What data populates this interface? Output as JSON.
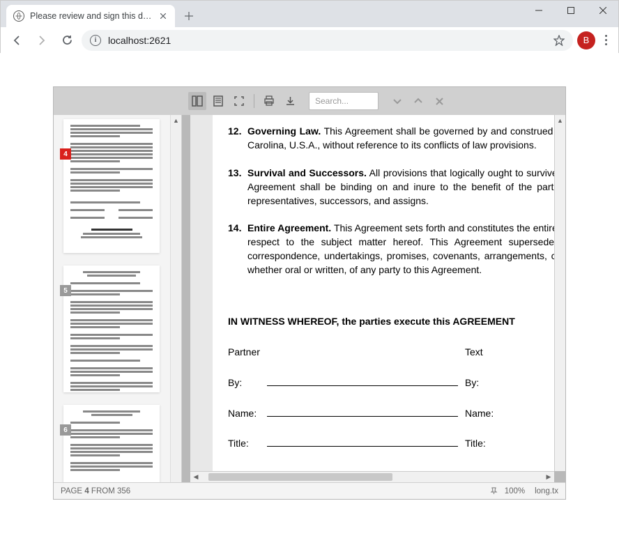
{
  "window": {
    "tab_title": "Please review and sign this docu",
    "url": "localhost:2621",
    "avatar_letter": "B"
  },
  "toolbar": {
    "search_placeholder": "Search..."
  },
  "thumbnails": [
    {
      "num": "4",
      "active": true
    },
    {
      "num": "5",
      "active": false
    },
    {
      "num": "6",
      "active": false
    }
  ],
  "document": {
    "clauses": [
      {
        "num": "12.",
        "heading": "Governing Law.",
        "body": " This Agreement shall be governed by and construed in accordance with the laws of the State of North Carolina, U.S.A., without reference to its conflicts of law provisions."
      },
      {
        "num": "13.",
        "heading": "Survival and Successors.",
        "body": " All provisions that logically ought to survive termination of this Agreement shall survive. This Agreement shall be binding on and inure to the benefit of the parties and their respective heirs, legal or personal representatives, successors, and assigns."
      },
      {
        "num": "14.",
        "heading": "Entire Agreement.",
        "body": " This Agreement sets forth and constitutes the entire agreement and understanding of the parties with respect to the subject matter hereof. This Agreement supersedes any and all prior Agreements, negotiations, correspondence, undertakings, promises, covenants, arrangements, communications, representations, and warranties, whether oral or written, of any party to this Agreement."
      }
    ],
    "witness": "IN WITNESS WHEREOF, the parties execute this AGREEMENT",
    "sig_headers": {
      "left": "Partner",
      "right": "Text"
    },
    "sig_rows": [
      {
        "left_label": "By:",
        "right_label": "By:"
      },
      {
        "left_label": "Name:",
        "right_label": "Name:"
      },
      {
        "left_label": "Title:",
        "right_label": "Title:"
      }
    ]
  },
  "status": {
    "page_prefix": "PAGE ",
    "page_current": "4",
    "page_middle": " FROM ",
    "page_total": "356",
    "zoom": "100%",
    "filename": "long.tx"
  }
}
